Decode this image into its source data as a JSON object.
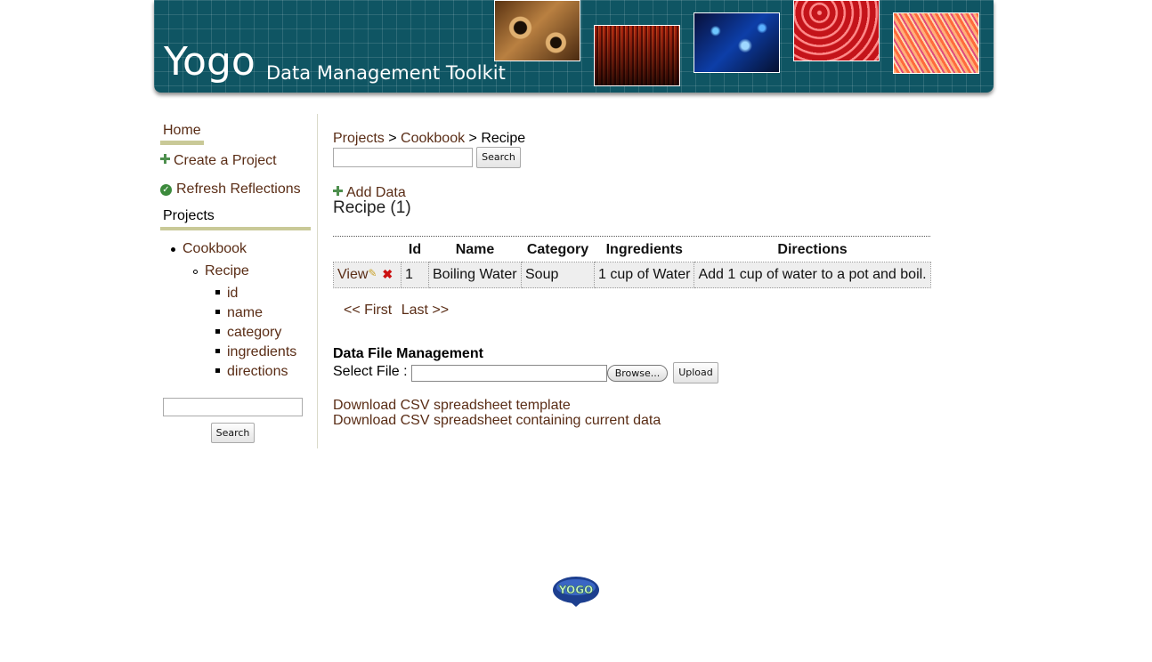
{
  "header": {
    "brand": "Yogo",
    "tagline": "Data Management Toolkit"
  },
  "sidebar": {
    "home_label": "Home",
    "create_project_label": "Create a Project",
    "refresh_label": "Refresh Reflections",
    "projects_heading": "Projects",
    "tree": {
      "project": "Cookbook",
      "model": "Recipe",
      "fields": [
        "id",
        "name",
        "category",
        "ingredients",
        "directions"
      ]
    },
    "search": {
      "value": "",
      "button_label": "Search"
    }
  },
  "main": {
    "breadcrumb": {
      "items": [
        "Projects",
        "Cookbook",
        "Recipe"
      ],
      "separator": ">"
    },
    "search": {
      "value": "",
      "button_label": "Search"
    },
    "add_data_label": "Add Data",
    "title": "Recipe (1)",
    "table": {
      "columns": [
        "",
        "Id",
        "Name",
        "Category",
        "Ingredients",
        "Directions"
      ],
      "rows": [
        {
          "view_label": "View",
          "id": "1",
          "name": "Boiling Water",
          "category": "Soup",
          "ingredients": "1 cup of Water",
          "directions": "Add 1 cup of water to a pot and boil."
        }
      ]
    },
    "pager": {
      "first_label": "<< First",
      "last_label": "Last >>"
    },
    "file_management": {
      "heading": "Data File Management",
      "select_label": "Select File :",
      "browse_label": "Browse...",
      "upload_label": "Upload",
      "file_value": ""
    },
    "links": {
      "csv_template": "Download CSV spreadsheet template",
      "csv_data": "Download CSV spreadsheet containing current data"
    }
  },
  "footer": {
    "logo_text": "YOGO"
  },
  "colors": {
    "header_bg": "#0f5563",
    "link": "#5a2d16",
    "nav_underline": "#c9c997",
    "plus_icon": "#4e8f4e",
    "delete_icon": "#cc1111"
  }
}
